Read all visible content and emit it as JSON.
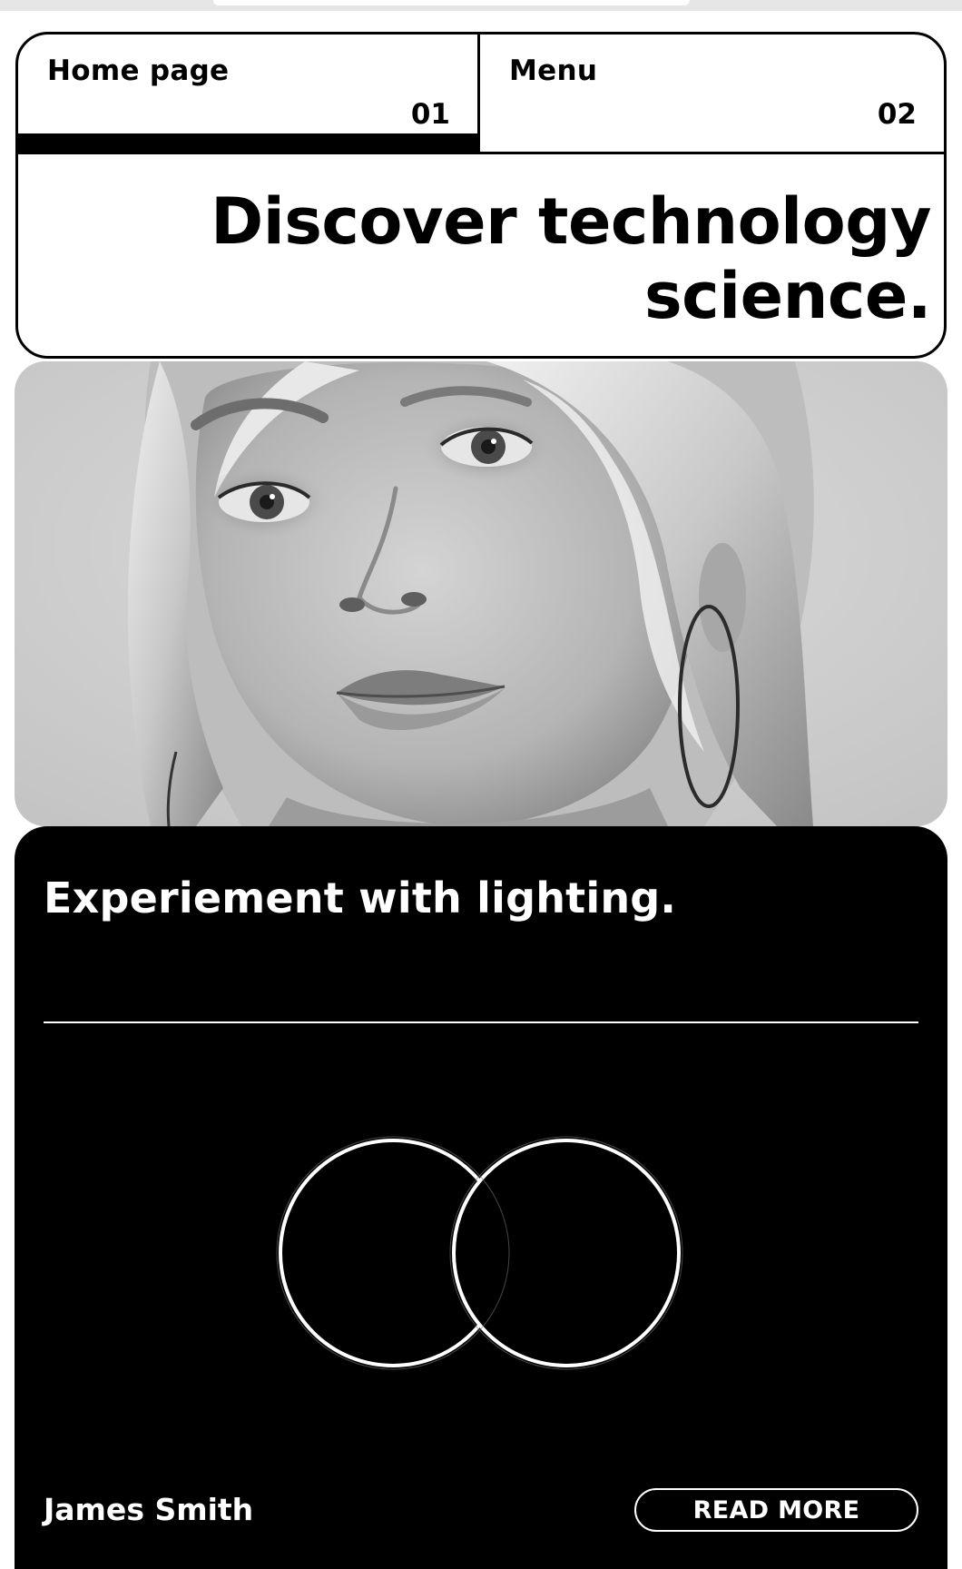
{
  "nav": {
    "items": [
      {
        "label": "Home page",
        "number": "01"
      },
      {
        "label": "Menu",
        "number": "02"
      }
    ]
  },
  "hero": {
    "headline_line1": "Discover technology",
    "headline_line2": "science."
  },
  "photo": {
    "icon": "portrait-photo-grayscale"
  },
  "card": {
    "title": "Experiement with lighting.",
    "author": "James Smith",
    "read_more_label": "READ MORE",
    "graphic_icon": "two-overlapping-rings-icon"
  },
  "colors": {
    "background": "#ffffff",
    "ink": "#000000",
    "card_background": "#000000",
    "card_text": "#ffffff"
  }
}
